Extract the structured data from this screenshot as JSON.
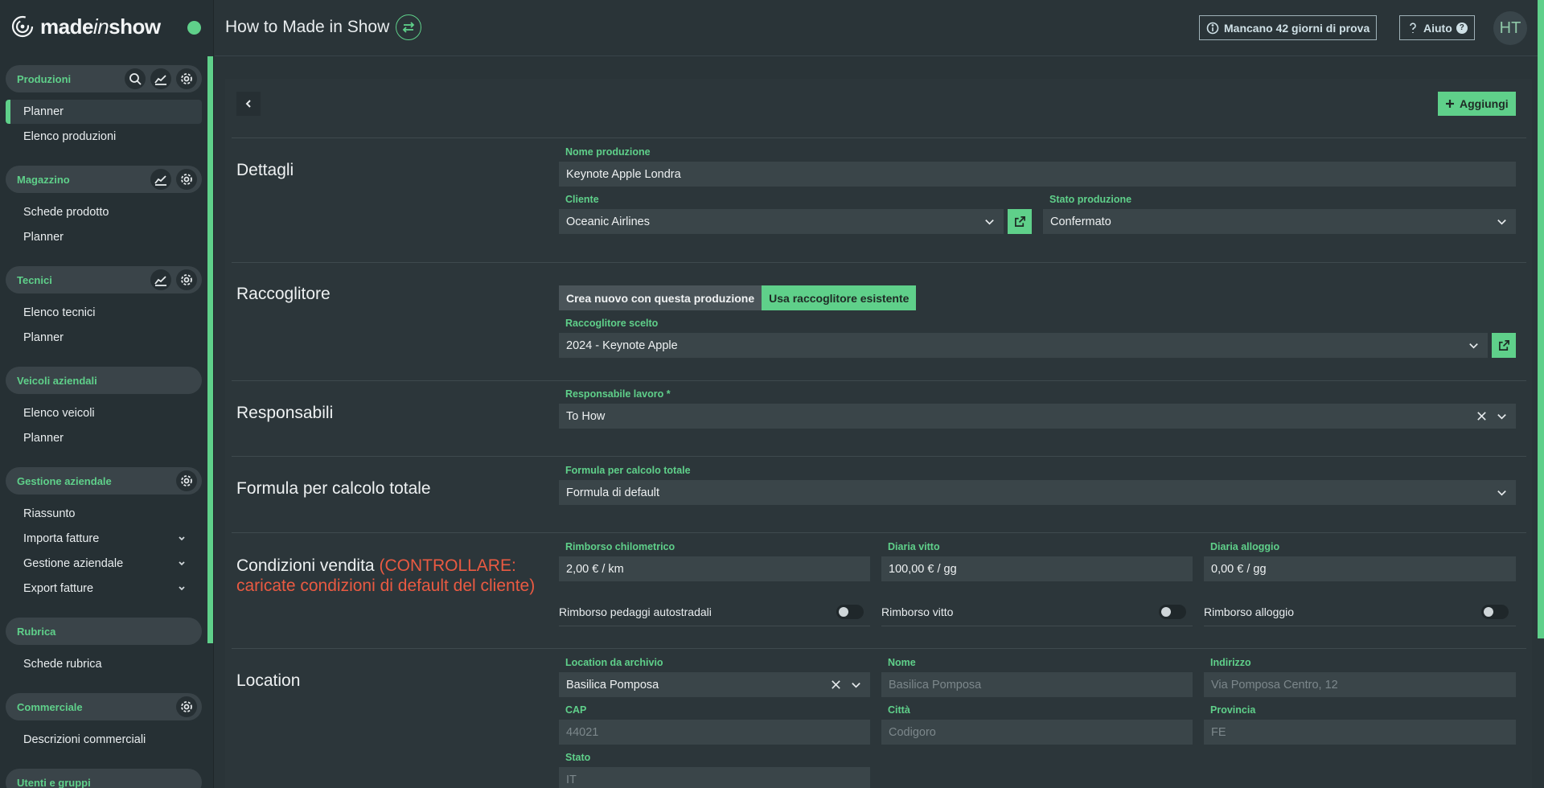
{
  "brand": {
    "name_bold1": "made",
    "name_italic": "in",
    "name_bold2": "show",
    "accent": "#5fd08a"
  },
  "header": {
    "title": "How to Made in Show",
    "trial_label": "Mancano 42 giorni di prova",
    "help_label": "Aiuto",
    "avatar_initials": "HT"
  },
  "sidebar": {
    "sections": [
      {
        "title": "Produzioni",
        "items": [
          "Planner",
          "Elenco produzioni"
        ]
      },
      {
        "title": "Magazzino",
        "items": [
          "Schede prodotto",
          "Planner"
        ]
      },
      {
        "title": "Tecnici",
        "items": [
          "Elenco tecnici",
          "Planner"
        ]
      },
      {
        "title": "Veicoli aziendali",
        "items": [
          "Elenco veicoli",
          "Planner"
        ]
      },
      {
        "title": "Gestione aziendale",
        "items": [
          "Riassunto",
          "Importa fatture",
          "Gestione aziendale",
          "Export fatture"
        ]
      },
      {
        "title": "Rubrica",
        "items": [
          "Schede rubrica"
        ]
      },
      {
        "title": "Commerciale",
        "items": [
          "Descrizioni commerciali"
        ]
      },
      {
        "title": "Utenti e gruppi",
        "items": []
      }
    ]
  },
  "toolbar": {
    "add_label": "Aggiungi"
  },
  "dettagli": {
    "title": "Dettagli",
    "nome_label": "Nome produzione",
    "nome_value": "Keynote Apple Londra",
    "cliente_label": "Cliente",
    "cliente_value": "Oceanic Airlines",
    "stato_label": "Stato produzione",
    "stato_value": "Confermato"
  },
  "raccoglitore": {
    "title": "Raccoglitore",
    "opt_new": "Crea nuovo con questa produzione",
    "opt_existing": "Usa raccoglitore esistente",
    "scelto_label": "Raccoglitore scelto",
    "scelto_value": "2024 - Keynote Apple"
  },
  "responsabili": {
    "title": "Responsabili",
    "label": "Responsabile lavoro *",
    "value": "To How"
  },
  "formula": {
    "title": "Formula per calcolo totale",
    "label": "Formula per calcolo totale",
    "value": "Formula di default"
  },
  "condizioni": {
    "title": "Condizioni vendita",
    "warning_line1": "(CONTROLLARE:",
    "warning_line2": "caricate condizioni di default del cliente)",
    "km_label": "Rimborso chilometrico",
    "km_value": "2,00 € / km",
    "vitto_label": "Diaria vitto",
    "vitto_value": "100,00 € / gg",
    "alloggio_label": "Diaria alloggio",
    "alloggio_value": "0,00 € / gg",
    "toggle_pedaggi": "Rimborso pedaggi autostradali",
    "toggle_vitto": "Rimborso vitto",
    "toggle_alloggio": "Rimborso alloggio"
  },
  "location": {
    "title": "Location",
    "archivio_label": "Location da archivio",
    "archivio_value": "Basilica Pomposa",
    "nome_label": "Nome",
    "nome_value": "Basilica Pomposa",
    "indirizzo_label": "Indirizzo",
    "indirizzo_value": "Via Pomposa Centro, 12",
    "cap_label": "CAP",
    "cap_value": "44021",
    "citta_label": "Città",
    "citta_value": "Codigoro",
    "provincia_label": "Provincia",
    "provincia_value": "FE",
    "stato_label": "Stato",
    "stato_value": "IT"
  }
}
